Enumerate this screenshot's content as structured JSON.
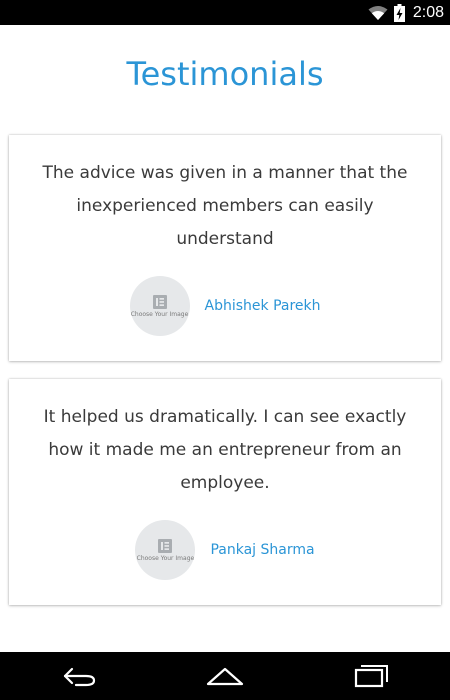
{
  "status_bar": {
    "time": "2:08",
    "icons": [
      "wifi-icon",
      "battery-icon"
    ]
  },
  "page": {
    "title": "Testimonials"
  },
  "testimonials": [
    {
      "quote": "The advice was given in a manner that the inexperienced members can easily understand",
      "avatar_placeholder": "Choose Your Image",
      "author": "Abhishek Parekh"
    },
    {
      "quote": "It helped us dramatically. I can see exactly how it made me an entrepreneur from an employee.",
      "avatar_placeholder": "Choose Your Image",
      "author": "Pankaj Sharma"
    }
  ],
  "navigation": {
    "icons": [
      "back-icon",
      "home-icon",
      "recent-apps-icon"
    ]
  },
  "colors": {
    "accent": "#2b95d6",
    "text": "#3a3a3a",
    "avatar_bg": "#e6e8ea",
    "system_bar": "#000000"
  }
}
